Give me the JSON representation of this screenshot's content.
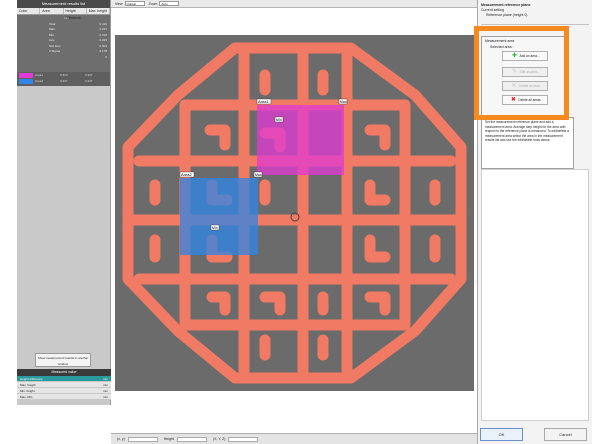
{
  "left_panel": {
    "title": "Measurement results list",
    "columns": [
      "Color",
      "Area",
      "Height difference",
      "Max. height"
    ],
    "unit": "mm",
    "rows": [
      {
        "label": "Total",
        "value": "0.410"
      },
      {
        "label": "Max.",
        "value": "0.337"
      },
      {
        "label": "Min.",
        "value": "0.310"
      },
      {
        "label": "Ave.",
        "value": "0.323"
      },
      {
        "label": "Std. Dev.",
        "value": "0.004"
      },
      {
        "label": "3 Sigma",
        "value": "0.178"
      },
      {
        "label": "",
        "value": "0"
      }
    ],
    "areas": [
      {
        "name": "Area1",
        "value": "0.310",
        "value2": "0.337",
        "color": "#e23ad4"
      },
      {
        "name": "Area2",
        "value": "0.337",
        "value2": "0.337",
        "color": "#2f86e8"
      }
    ],
    "show_button": "Show measurement results in another window",
    "measured_value_header": "Measured value",
    "measured_values": [
      {
        "label": "Height difference",
        "unit": "mm",
        "selected": true
      },
      {
        "label": "Max. height",
        "unit": "mm",
        "selected": false
      },
      {
        "label": "Min. height",
        "unit": "mm",
        "selected": false
      },
      {
        "label": "Max.-Min.",
        "unit": "mm",
        "selected": false
      }
    ]
  },
  "toolbar": {
    "view_label": "View",
    "view_value": "Optical",
    "zoom_label": "Zoom",
    "zoom_value": "Auto"
  },
  "image": {
    "area1_label": "Area1",
    "area2_label": "Area2",
    "min_tag": "Min",
    "max_tag": "Max",
    "area1_color": "#e23ad4",
    "area2_color": "#2f86e8",
    "print_color": "#f07a63"
  },
  "statusbar": {
    "xy_label": "(x, y)",
    "height_label": "Height",
    "xyz_label": "(X, Y, Z)"
  },
  "right_panel": {
    "title": "Measurement reference plane",
    "current_setting_label": "Current setting",
    "current_setting_value": "Reference plane (height 0)",
    "measurement_area_title": "Measurement area",
    "selected_area_label": "Selected area :",
    "buttons": {
      "add": "Add an area...",
      "edit": "Edit an area...",
      "delete": "Delete an area",
      "delete_all": "Delete all areas"
    },
    "note": "Set the measurement reference plane and add a measurement area. Average step height for the area with respect to the reference plane is measured. To edit/delete a measurement area select the area in the measurement results list and use the edit/delete tools above.",
    "ok": "OK",
    "cancel": "Cancel"
  }
}
